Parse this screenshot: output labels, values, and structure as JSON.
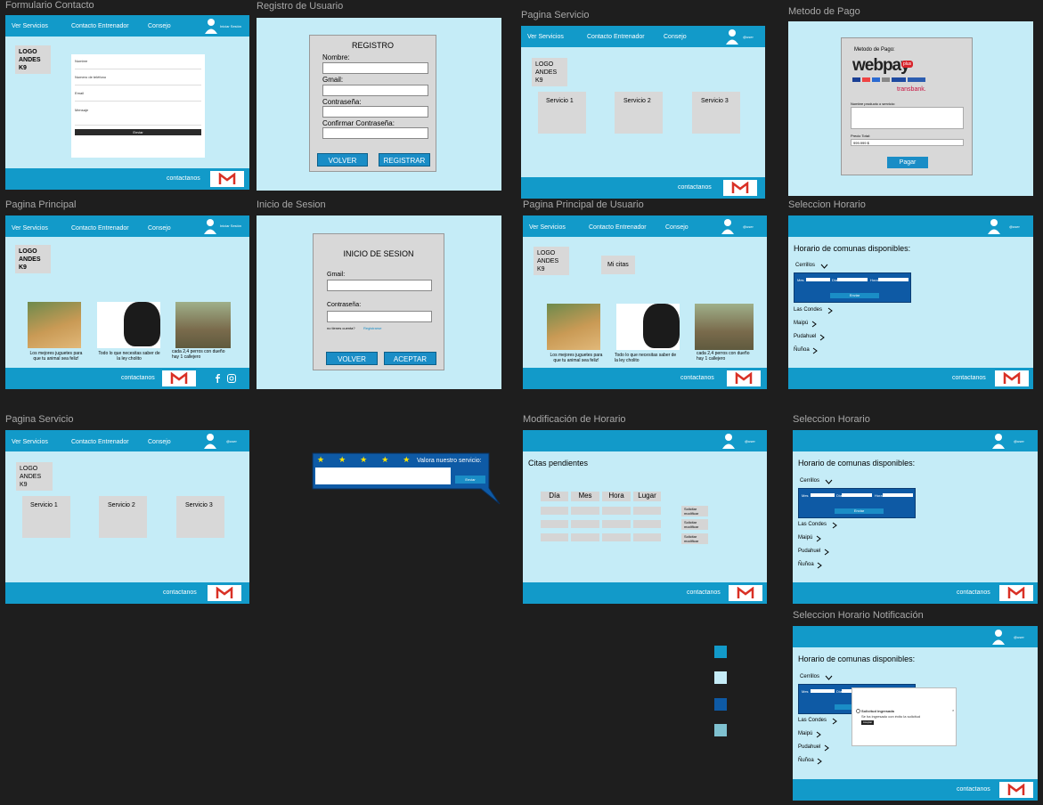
{
  "labels": {
    "f1": "Formulario Contacto",
    "f2": "Registro de Usuario",
    "f3": "Pagina Servicio",
    "f4": "Metodo de Pago",
    "f5": "Pagina Principal",
    "f6": "Inicio de Sesion",
    "f7": "Pagina Principal de Usuario",
    "f8": "Seleccion Horario",
    "f9": "Pagina Servicio",
    "f10": "Modificación de Horario",
    "f11": "Seleccion Horario",
    "f12": "Seleccion Horario Notificación"
  },
  "nav": {
    "ver_servicios": "Ver Servicios",
    "contacto_entrenador": "Contacto Entrenador",
    "consejo": "Consejo",
    "iniciar_sesion": "Iniciar Sesión",
    "user": "@user"
  },
  "footer": {
    "contactanos": "contactanos"
  },
  "logo": {
    "l1": "LOGO",
    "l2": "ANDES",
    "l3": "K9"
  },
  "contact_form": {
    "f1": "Nombre",
    "f2": "Numero de teléfono",
    "f3": "Email",
    "f4": "Mensaje",
    "send": "Enviar"
  },
  "register": {
    "title": "REGISTRO",
    "nombre": "Nombre:",
    "gmail": "Gmail:",
    "pass": "Contraseña:",
    "confirm": "Confirmar Contraseña:",
    "back": "VOLVER",
    "submit": "REGISTRAR"
  },
  "service": {
    "s1": "Servicio 1",
    "s2": "Servicio 2",
    "s3": "Servicio 3"
  },
  "payment": {
    "title": "Metodo de Pago:",
    "brand": "webpay",
    "plus": "plus",
    "transbank": "transbank.",
    "name_label": "Nombre producto o servicio:",
    "total_label": "Precio Total:",
    "total_value": "999.999 $",
    "pay": "Pagar"
  },
  "login": {
    "title": "INICIO DE SESION",
    "gmail": "Gmail:",
    "pass": "Contraseña:",
    "noaccount": "no tienes cuenta?",
    "register_link": "Registrarse",
    "back": "VOLVER",
    "accept": "ACEPTAR"
  },
  "home": {
    "c1a": "Los mejores juguetes para",
    "c1b": "que tu animal sea feliz!",
    "c2a": "Todo lo que necesitas saber de",
    "c2b": "la ley cholito",
    "c3a": "cada 2,4 perros con dueño",
    "c3b": "hay 1 callejero"
  },
  "user_home": {
    "mis_citas": "Mi citas"
  },
  "schedule": {
    "title": "Horario de comunas disponibles:",
    "cerrillos": "Cerrillos",
    "mes": "Mes",
    "dia": "Día",
    "hora": "Hora",
    "enviar": "Enviar",
    "las_condes": "Las Condes",
    "maipu": "Maipú",
    "pudahuel": "Pudahuel",
    "nunoa": "Ñuñoa"
  },
  "rating": {
    "label": "Valora nuestro servicio:",
    "send": "Enviar",
    "stars": 5
  },
  "modify": {
    "title": "Citas pendientes",
    "dia": "Día",
    "mes": "Mes",
    "hora": "Hora",
    "lugar": "Lugar",
    "req1": "Solicitar",
    "req2": "modificar"
  },
  "notification": {
    "title": "Solicitud ingresada",
    "body": "Se ha ingresado con éxito la solicitud",
    "ok": "Aceptar"
  },
  "colors": {
    "primary": "#129ac9",
    "light": "#c5ecf7",
    "dark": "#0e5aa5",
    "muted": "#7fc1d0"
  }
}
